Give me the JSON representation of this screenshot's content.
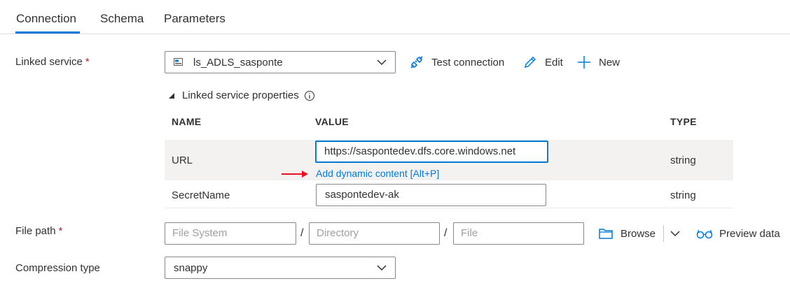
{
  "tabs": [
    {
      "label": "Connection",
      "active": true
    },
    {
      "label": "Schema",
      "active": false
    },
    {
      "label": "Parameters",
      "active": false
    }
  ],
  "linked_service": {
    "label": "Linked service",
    "required_mark": "*",
    "selected": "ls_ADLS_sasponte",
    "actions": {
      "test": "Test connection",
      "edit": "Edit",
      "new": "New"
    }
  },
  "properties": {
    "title": "Linked service properties",
    "columns": {
      "name": "NAME",
      "value": "VALUE",
      "type": "TYPE"
    },
    "rows": [
      {
        "name": "URL",
        "value": "https://saspontedev.dfs.core.windows.net",
        "type": "string",
        "dynamic_link": "Add dynamic content [Alt+P]"
      },
      {
        "name": "SecretName",
        "value": "saspontedev-ak",
        "type": "string"
      }
    ]
  },
  "file_path": {
    "label": "File path",
    "required_mark": "*",
    "file_system_placeholder": "File System",
    "directory_placeholder": "Directory",
    "file_placeholder": "File",
    "separator": "/",
    "browse": "Browse",
    "preview": "Preview data"
  },
  "compression": {
    "label": "Compression type",
    "selected": "snappy"
  },
  "colors": {
    "accent": "#0078d4",
    "required": "#a4262c",
    "annotation_arrow": "#e81123"
  }
}
